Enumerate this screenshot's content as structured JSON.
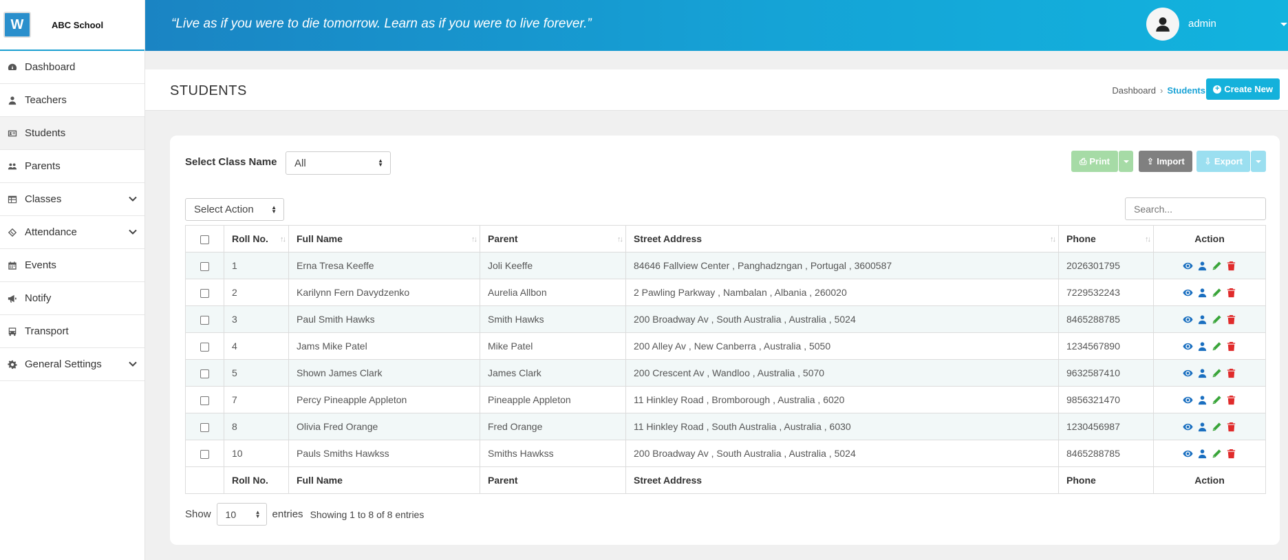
{
  "app": {
    "name": "ABC School",
    "logo_text": "W"
  },
  "header": {
    "quote": "“Live as if you were to die tomorrow. Learn as if you were to live forever.”",
    "user": "admin"
  },
  "sidebar": {
    "items": [
      {
        "label": "Dashboard",
        "icon": "dashboard-icon"
      },
      {
        "label": "Teachers",
        "icon": "user-icon"
      },
      {
        "label": "Students",
        "icon": "id-card-icon"
      },
      {
        "label": "Parents",
        "icon": "users-icon"
      },
      {
        "label": "Classes",
        "icon": "table-icon"
      },
      {
        "label": "Attendance",
        "icon": "ticket-icon"
      },
      {
        "label": "Events",
        "icon": "calendar-icon"
      },
      {
        "label": "Notify",
        "icon": "bullhorn-icon"
      },
      {
        "label": "Transport",
        "icon": "bus-icon"
      },
      {
        "label": "General Settings",
        "icon": "gear-icon"
      }
    ]
  },
  "page": {
    "title": "STUDENTS",
    "breadcrumb_home": "Dashboard",
    "breadcrumb_current": "Students",
    "create_label": "Create New"
  },
  "filters": {
    "class_label": "Select Class Name",
    "class_value": "All",
    "action_value": "Select Action",
    "search_placeholder": "Search..."
  },
  "toolbar": {
    "print": "Print",
    "import": "Import",
    "export": "Export"
  },
  "table": {
    "columns": [
      "Roll No.",
      "Full Name",
      "Parent",
      "Street Address",
      "Phone",
      "Action"
    ],
    "rows": [
      {
        "roll": "1",
        "name": "Erna Tresa Keeffe",
        "parent": "Joli Keeffe",
        "address": "84646 Fallview Center , Panghadzngan , Portugal , 3600587",
        "phone": "2026301795"
      },
      {
        "roll": "2",
        "name": "Karilynn Fern Davydzenko",
        "parent": "Aurelia Allbon",
        "address": "2 Pawling Parkway , Nambalan , Albania , 260020",
        "phone": "7229532243"
      },
      {
        "roll": "3",
        "name": "Paul Smith Hawks",
        "parent": "Smith Hawks",
        "address": "200 Broadway Av , South Australia , Australia , 5024",
        "phone": "8465288785"
      },
      {
        "roll": "4",
        "name": "Jams Mike Patel",
        "parent": "Mike Patel",
        "address": "200 Alley Av , New Canberra , Australia , 5050",
        "phone": "1234567890"
      },
      {
        "roll": "5",
        "name": "Shown James Clark",
        "parent": "James Clark",
        "address": "200 Crescent Av , Wandloo , Australia , 5070",
        "phone": "9632587410"
      },
      {
        "roll": "7",
        "name": "Percy Pineapple Appleton",
        "parent": "Pineapple Appleton",
        "address": "11 Hinkley Road , Bromborough , Australia , 6020",
        "phone": "9856321470"
      },
      {
        "roll": "8",
        "name": "Olivia Fred Orange",
        "parent": "Fred Orange",
        "address": "11 Hinkley Road , South Australia , Australia , 6030",
        "phone": "1230456987"
      },
      {
        "roll": "10",
        "name": "Pauls Smiths Hawkss",
        "parent": "Smiths Hawkss",
        "address": "200 Broadway Av , South Australia , Australia , 5024",
        "phone": "8465288785"
      }
    ]
  },
  "footer": {
    "show_label": "Show",
    "page_length": "10",
    "entries_label": "entries",
    "info": "Showing 1 to 8 of 8 entries"
  },
  "colors": {
    "brand": "#1aa3d6",
    "view": "#1a6fc0",
    "user": "#1a6fc0",
    "edit": "#3aa53a",
    "delete": "#e02b2b"
  }
}
